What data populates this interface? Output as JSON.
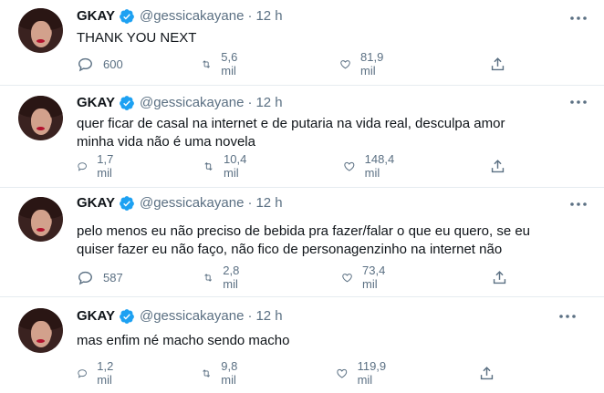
{
  "tweets": [
    {
      "name": "GKAY",
      "handle": "@gessicakayane",
      "separator": "·",
      "time": "12 h",
      "text_lines": [
        "THANK YOU NEXT"
      ],
      "replies": "600",
      "retweets": "5,6 mil",
      "likes": "81,9 mil"
    },
    {
      "name": "GKAY",
      "handle": "@gessicakayane",
      "separator": "·",
      "time": "12 h",
      "text_lines": [
        "quer ficar de casal na internet e de putaria na vida real, desculpa amor",
        "minha vida não é uma novela"
      ],
      "replies": "1,7 mil",
      "retweets": "10,4 mil",
      "likes": "148,4 mil"
    },
    {
      "name": "GKAY",
      "handle": "@gessicakayane",
      "separator": "·",
      "time": "12 h",
      "text_lines": [
        "pelo menos eu não preciso de bebida pra fazer/falar o que eu quero, se eu",
        "quiser fazer eu não faço, não fico de personagenzinho na internet não"
      ],
      "replies": "587",
      "retweets": "2,8 mil",
      "likes": "73,4 mil"
    },
    {
      "name": "GKAY",
      "handle": "@gessicakayane",
      "separator": "·",
      "time": "12 h",
      "text_lines": [
        "mas enfim né macho sendo macho"
      ],
      "replies": "1,2 mil",
      "retweets": "9,8 mil",
      "likes": "119,9 mil"
    }
  ],
  "icons": {
    "verified": "verified-badge-icon",
    "more": "more-options-icon",
    "reply": "reply-icon",
    "retweet": "retweet-icon",
    "like": "like-icon",
    "share": "share-icon"
  },
  "colors": {
    "verified": "#1da1f2",
    "secondary_text": "#5b7083",
    "divider": "#e6ecf0"
  }
}
